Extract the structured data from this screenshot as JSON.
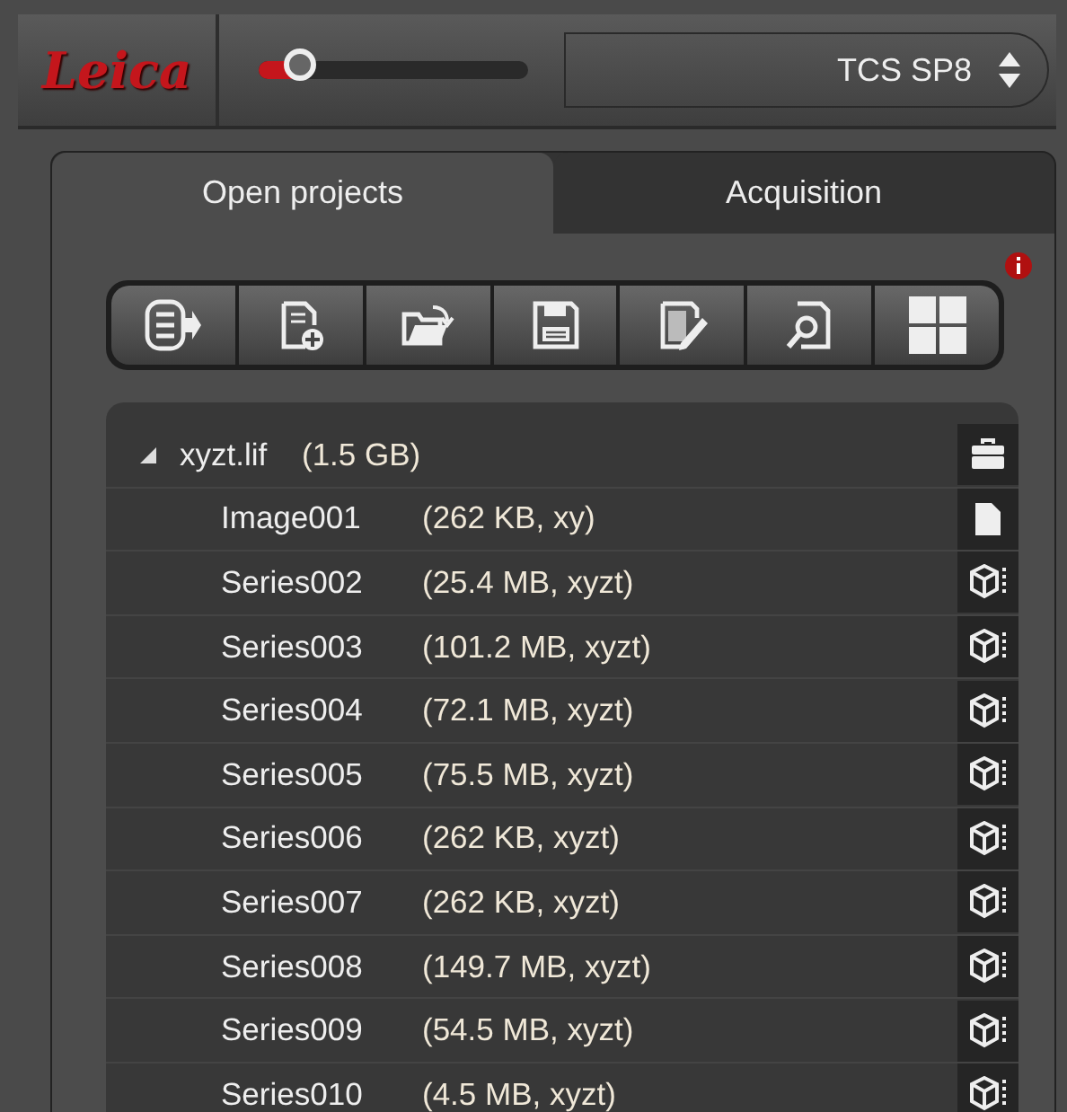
{
  "logo": "Leica",
  "slider": {
    "level": 0.15
  },
  "system_selector": {
    "value": "TCS SP8"
  },
  "tabs": [
    {
      "label": "Open projects",
      "selected": true
    },
    {
      "label": "Acquisition",
      "selected": false
    }
  ],
  "info_alert": true,
  "toolbar": [
    {
      "kind": "close"
    },
    {
      "kind": "new"
    },
    {
      "kind": "open"
    },
    {
      "kind": "save"
    },
    {
      "kind": "edit"
    },
    {
      "kind": "find"
    },
    {
      "kind": "layout"
    }
  ],
  "tree": [
    {
      "name": "xyzt.lif",
      "detail": "(1.5 GB)",
      "kind": "project",
      "expanded": true,
      "children": [
        {
          "name": "Image001",
          "detail": "(262 KB, xy)",
          "kind": "image"
        },
        {
          "name": "Series002",
          "detail": "(25.4 MB, xyzt)",
          "kind": "series"
        },
        {
          "name": "Series003",
          "detail": "(101.2 MB, xyzt)",
          "kind": "series"
        },
        {
          "name": "Series004",
          "detail": "(72.1 MB, xyzt)",
          "kind": "series"
        },
        {
          "name": "Series005",
          "detail": "(75.5 MB, xyzt)",
          "kind": "series"
        },
        {
          "name": "Series006",
          "detail": "(262 KB, xyzt)",
          "kind": "series"
        },
        {
          "name": "Series007",
          "detail": "(262 KB, xyzt)",
          "kind": "series"
        },
        {
          "name": "Series008",
          "detail": "(149.7 MB, xyzt)",
          "kind": "series"
        },
        {
          "name": "Series009",
          "detail": "(54.5 MB, xyzt)",
          "kind": "series"
        },
        {
          "name": "Series010",
          "detail": "(4.5 MB, xyzt)",
          "kind": "series"
        }
      ]
    }
  ]
}
